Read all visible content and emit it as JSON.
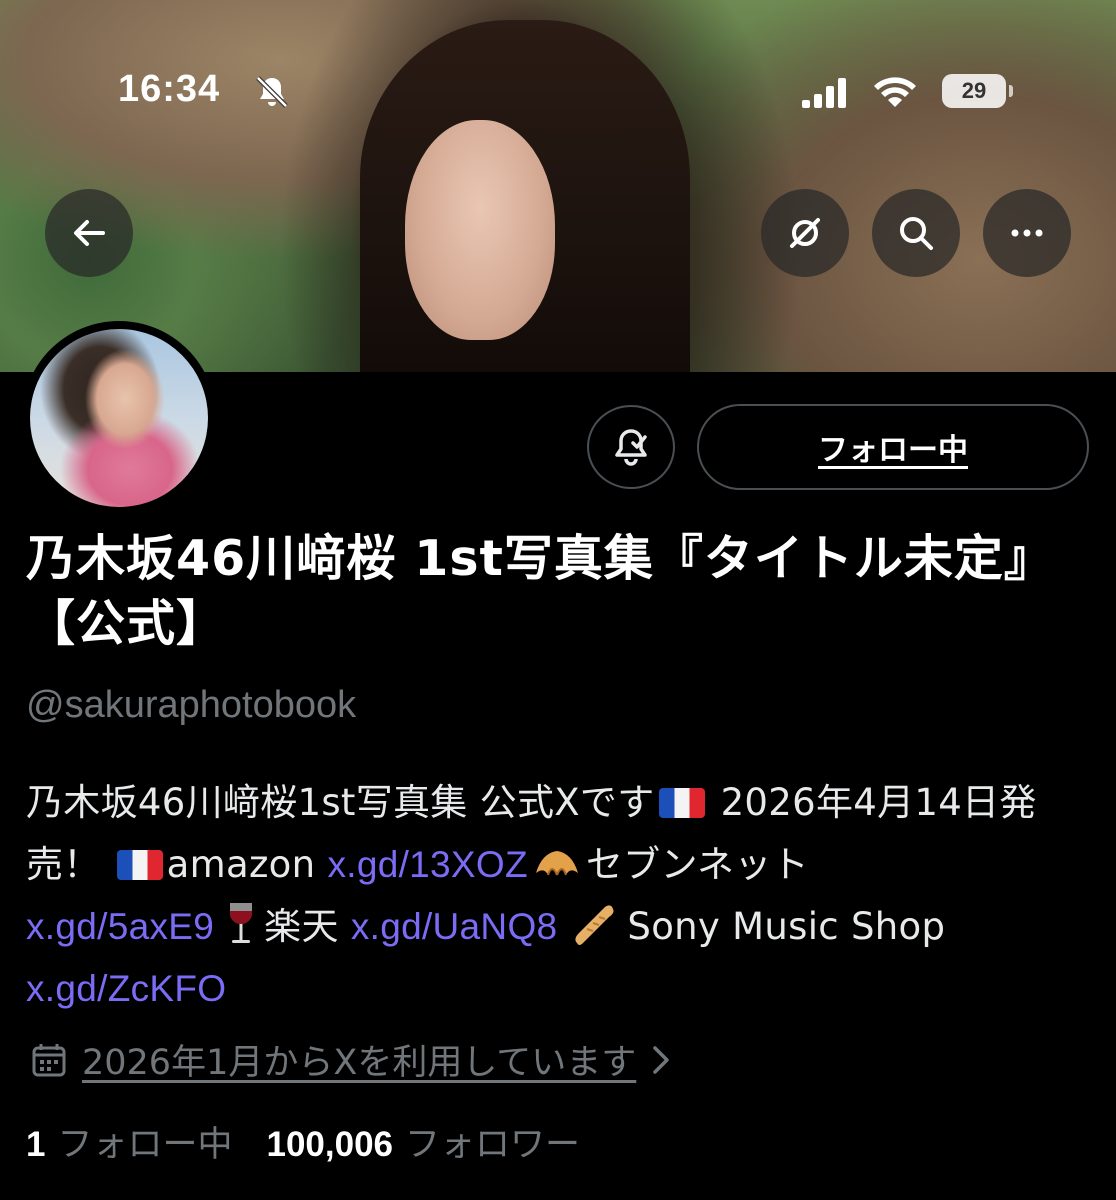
{
  "status_bar": {
    "time": "16:34",
    "battery": "29",
    "icons": [
      "bell-off-icon",
      "signal-icon",
      "wifi-icon",
      "battery-icon"
    ]
  },
  "header_buttons": {
    "back": "arrow-left-icon",
    "grok": "grok-icon",
    "search": "search-icon",
    "more": "more-icon"
  },
  "profile": {
    "display_name": "乃木坂46川﨑桜 1st写真集『タイトル未定』【公式】",
    "handle": "@sakuraphotobook",
    "follow_button": "フォロー中",
    "bio": {
      "part1": "乃木坂46川﨑桜1st写真集 公式Xです",
      "part2": " 2026年4月14日発売！ ",
      "amazon": "amazon ",
      "link1": "x.gd/13XOZ",
      "seven": "セブンネット",
      "link2": "x.gd/5axE9",
      "rakuten": "楽天 ",
      "link3": "x.gd/UaNQ8",
      "sony": "Sony Music Shop ",
      "link4": "x.gd/ZcKFO"
    },
    "joined": "2026年1月からXを利用しています",
    "following_count": "1",
    "following_label": "フォロー中",
    "followers_count": "100,006",
    "followers_label": "フォロワー"
  },
  "colors": {
    "background": "#000000",
    "link": "#7b6cf6",
    "muted": "#71767b",
    "text": "#e7e9ea"
  }
}
